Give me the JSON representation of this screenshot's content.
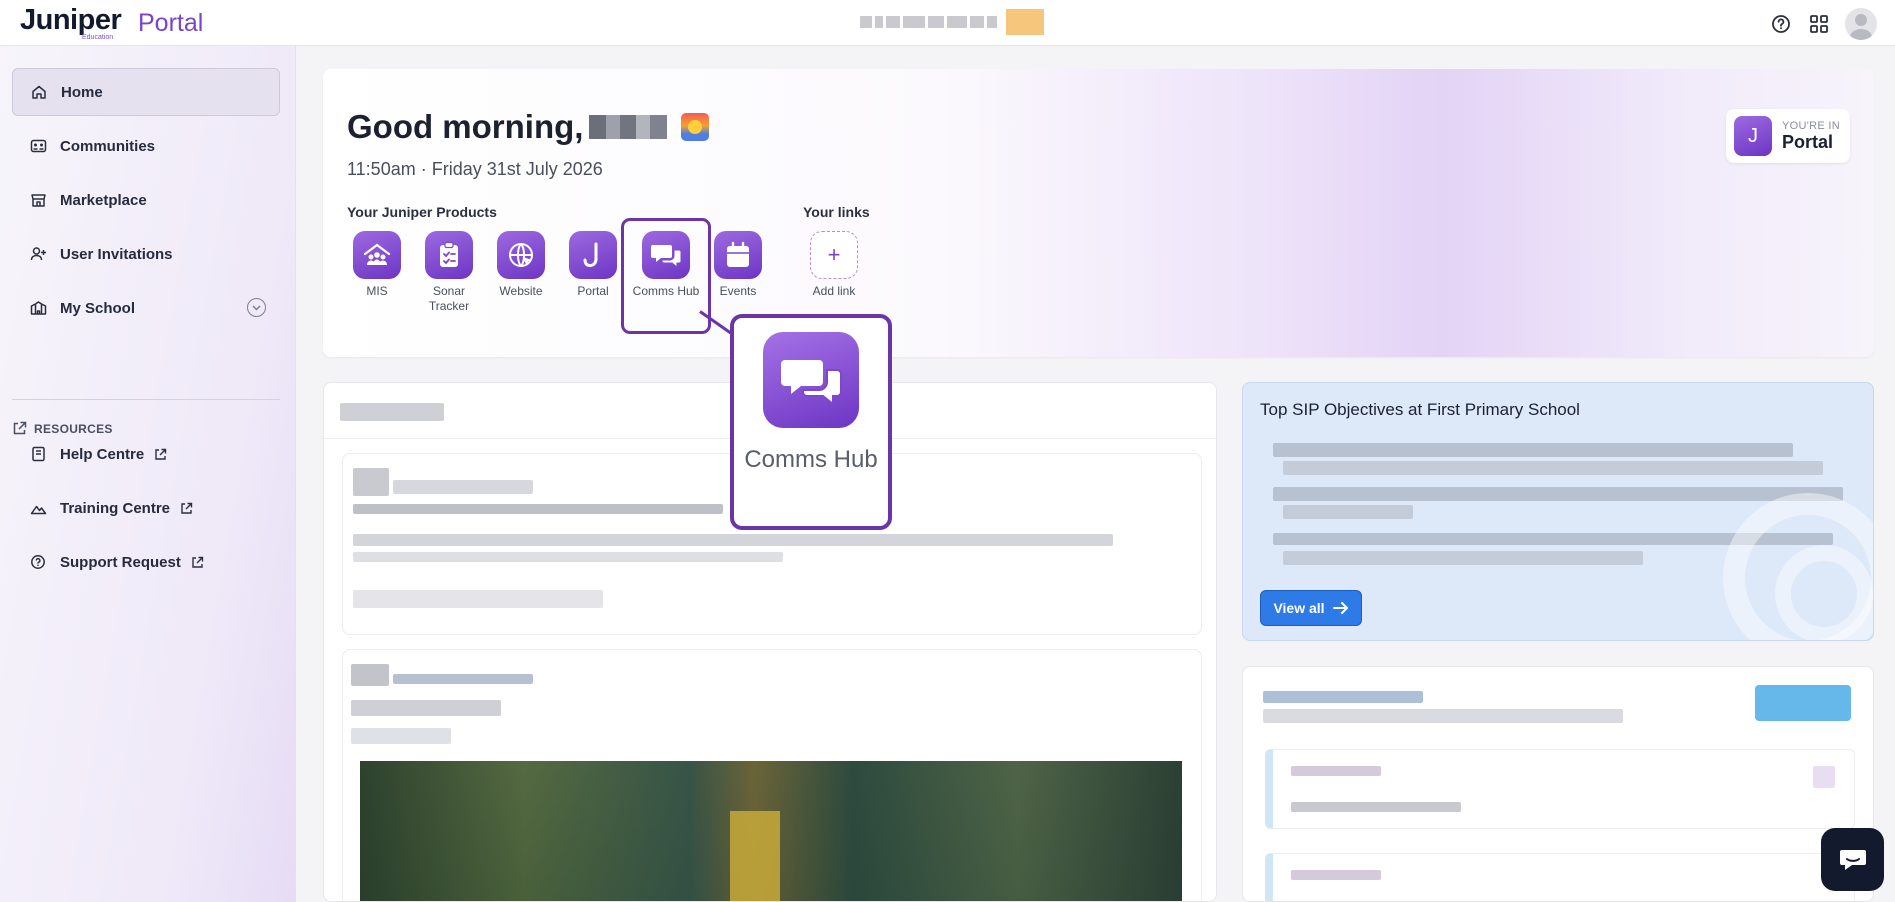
{
  "header": {
    "logo_word": "Juniper",
    "logo_sub": "Education",
    "logo_portal": "Portal",
    "icons": [
      "help-icon",
      "apps-grid-icon",
      "avatar"
    ]
  },
  "sidebar": {
    "items": [
      {
        "label": "Home",
        "icon": "home-icon",
        "active": true
      },
      {
        "label": "Communities",
        "icon": "communities-icon"
      },
      {
        "label": "Marketplace",
        "icon": "marketplace-icon"
      },
      {
        "label": "User Invitations",
        "icon": "user-add-icon"
      },
      {
        "label": "My School",
        "icon": "school-icon"
      }
    ],
    "resources_label": "RESOURCES",
    "resources": [
      {
        "label": "Help Centre",
        "icon": "book-icon"
      },
      {
        "label": "Training Centre",
        "icon": "training-icon"
      },
      {
        "label": "Support Request",
        "icon": "support-icon"
      }
    ]
  },
  "hero": {
    "greeting": "Good morning,",
    "datetime": "11:50am · Friday 31st July 2026",
    "products_label": "Your Juniper Products",
    "products": [
      {
        "label": "MIS",
        "icon": "mis-icon"
      },
      {
        "label": "Sonar Tracker",
        "icon": "clipboard-icon"
      },
      {
        "label": "Website",
        "icon": "globe-icon"
      },
      {
        "label": "Portal",
        "icon": "juniper-j-icon"
      },
      {
        "label": "Comms Hub",
        "icon": "chat-bubbles-icon",
        "highlighted": true
      },
      {
        "label": "Events",
        "icon": "calendar-icon"
      }
    ],
    "links_label": "Your links",
    "add_link_label": "Add link",
    "badge": {
      "small": "YOU'RE IN",
      "big": "Portal",
      "letter": "J"
    }
  },
  "callout": {
    "label": "Comms Hub"
  },
  "sip": {
    "title": "Top SIP Objectives at First Primary School",
    "view_all": "View all"
  },
  "colors": {
    "brand_purple": "#7a45c8",
    "callout_border": "#6b35a8",
    "view_all_blue": "#2e7be8",
    "chat_button": "#141a2e"
  }
}
